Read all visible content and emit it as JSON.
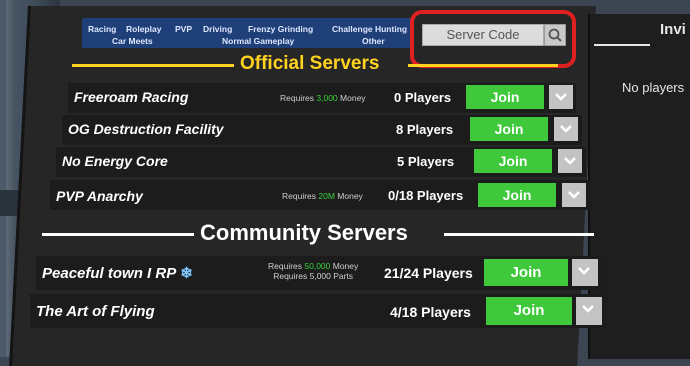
{
  "filters": {
    "tags": [
      "Racing",
      "Roleplay",
      "PVP",
      "Driving",
      "Frenzy Grinding",
      "Challenge Hunting",
      "Car Meets",
      "Normal Gameplay",
      "Other"
    ]
  },
  "search": {
    "placeholder": "Server Code"
  },
  "invite_panel": {
    "title": "Invi",
    "empty_text": "No players"
  },
  "official": {
    "title": "Official Servers",
    "servers": [
      {
        "name": "Freeroam Racing",
        "req_pre": "Requires ",
        "req_amount": "3,000",
        "req_post": " Money",
        "players": "0 Players",
        "join": "Join"
      },
      {
        "name": "OG Destruction Facility",
        "players": "8 Players",
        "join": "Join"
      },
      {
        "name": "No Energy Core",
        "players": "5 Players",
        "join": "Join"
      },
      {
        "name": "PVP Anarchy",
        "req_pre": "Requires ",
        "req_amount": "20M",
        "req_post": " Money",
        "players": "0/18 Players",
        "join": "Join"
      }
    ]
  },
  "community": {
    "title": "Community Servers",
    "servers": [
      {
        "name": "Peaceful town I RP",
        "emoji": "❄",
        "req_pre": "Requires ",
        "req_amount": "50,000",
        "req_post": " Money",
        "req2": "Requires 5,000 Parts",
        "players": "21/24 Players",
        "join": "Join"
      },
      {
        "name": "The Art of Flying",
        "players": "4/18 Players",
        "join": "Join"
      }
    ]
  },
  "colors": {
    "accent_yellow": "#ffd21f",
    "join_green": "#3fc83c",
    "highlight_green": "#39d23a",
    "annotation_red": "#e02020",
    "tag_blue": "#1f3f78"
  }
}
